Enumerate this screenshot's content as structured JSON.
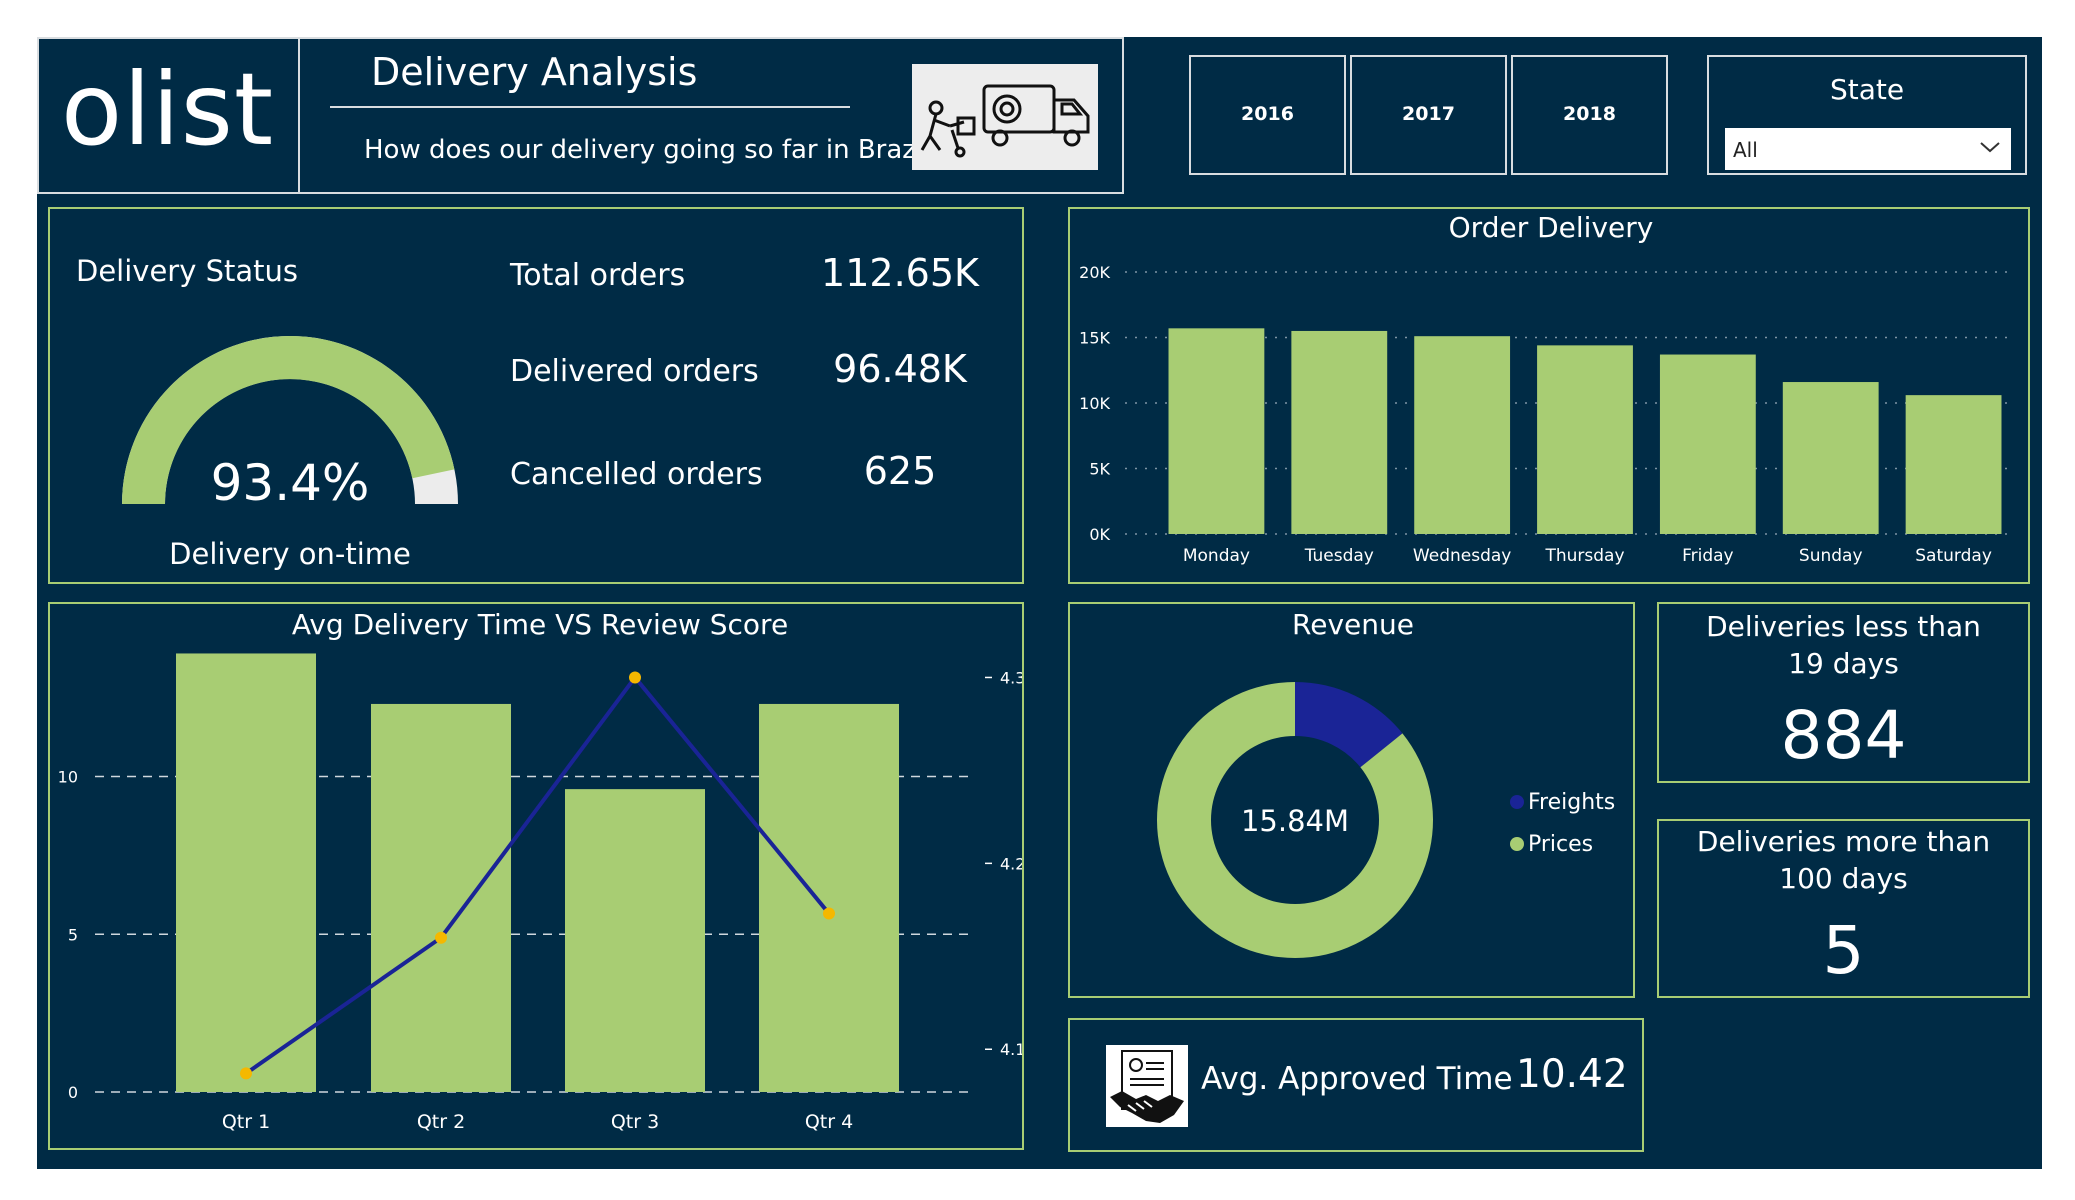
{
  "header": {
    "logo": "olist",
    "title": "Delivery Analysis",
    "subtitle": "How does our delivery going so far in Brazil?",
    "icon": "delivery-truck-icon"
  },
  "year_filters": [
    "2016",
    "2017",
    "2018"
  ],
  "state_filter": {
    "label": "State",
    "selected": "All"
  },
  "delivery_status": {
    "title": "Delivery Status",
    "gauge_value": "93.4%",
    "gauge_fraction": 0.934,
    "gauge_label": "Delivery on-time",
    "kpis": [
      {
        "label": "Total orders",
        "value": "112.65K"
      },
      {
        "label": "Delivered orders",
        "value": "96.48K"
      },
      {
        "label": "Cancelled orders",
        "value": "625"
      }
    ]
  },
  "deliveries_lt_19": {
    "label": "Deliveries less than 19 days",
    "value": "884"
  },
  "deliveries_gt_100": {
    "label": "Deliveries more than 100 days",
    "value": "5"
  },
  "approved_time": {
    "label": "Avg. Approved Time",
    "value": "10.42",
    "icon": "contract-handshake-icon"
  },
  "colors": {
    "background": "#002b45",
    "accent": "#a8cd73",
    "navy": "#1a2496",
    "marker": "#f5b800",
    "white": "#ffffff"
  },
  "chart_data": [
    {
      "type": "bar",
      "title": "Order Delivery",
      "categories": [
        "Monday",
        "Tuesday",
        "Wednesday",
        "Thursday",
        "Friday",
        "Sunday",
        "Saturday"
      ],
      "values": [
        15700,
        15500,
        15100,
        14400,
        13700,
        11600,
        10600
      ],
      "ylim": [
        0,
        20000
      ],
      "yticks": [
        "0K",
        "5K",
        "10K",
        "15K",
        "20K"
      ],
      "grid": true
    },
    {
      "type": "bar+line",
      "title": "Avg Delivery Time VS Review Score",
      "categories": [
        "Qtr 1",
        "Qtr 2",
        "Qtr 3",
        "Qtr 4"
      ],
      "bar_values": [
        13.9,
        12.3,
        9.6,
        12.3
      ],
      "bar_ylim": [
        0,
        14.2
      ],
      "bar_yticks": [
        "0",
        "5",
        "10"
      ],
      "line_values": [
        4.087,
        4.16,
        4.3,
        4.173
      ],
      "line_ylim": [
        4.077,
        4.318
      ],
      "line_yticks": [
        "4.1",
        "4.2",
        "4.3"
      ],
      "grid": true
    },
    {
      "type": "pie",
      "title": "Revenue",
      "center_label": "15.84M",
      "labels": [
        "Freights",
        "Prices"
      ],
      "values": [
        2.25,
        13.59
      ],
      "legend": "right"
    }
  ]
}
